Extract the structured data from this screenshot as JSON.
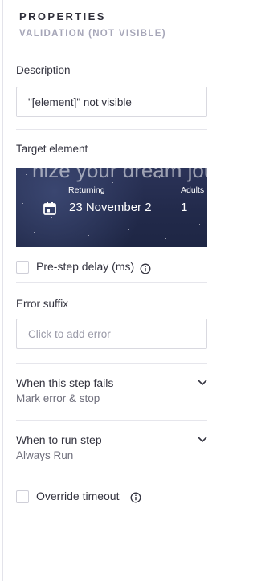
{
  "header": {
    "title": "PROPERTIES",
    "subtitle": "VALIDATION (NOT VISIBLE)"
  },
  "description": {
    "label": "Description",
    "value": "\"[element]\" not visible"
  },
  "target": {
    "label": "Target element",
    "preview": {
      "hero_text": "nize your dream jour",
      "returning_label": "Returning",
      "date_value": "23 November 2",
      "adults_label": "Adults",
      "adults_value": "1"
    }
  },
  "pre_step_delay": {
    "label": "Pre-step delay (ms)",
    "checked": false
  },
  "error_suffix": {
    "label": "Error suffix",
    "placeholder": "Click to add error"
  },
  "on_fail": {
    "title": "When this step fails",
    "value": "Mark error & stop"
  },
  "run_when": {
    "title": "When to run step",
    "value": "Always Run"
  },
  "override_timeout": {
    "label": "Override timeout",
    "checked": false
  },
  "colors": {
    "accent_dark": "#2e2e3a",
    "muted": "#a6a6b8",
    "border": "#d9d9e0",
    "preview_bg": "#232b4c"
  },
  "icons": {
    "calendar": "calendar-icon",
    "info": "info-icon",
    "chevron": "chevron-down-icon"
  }
}
